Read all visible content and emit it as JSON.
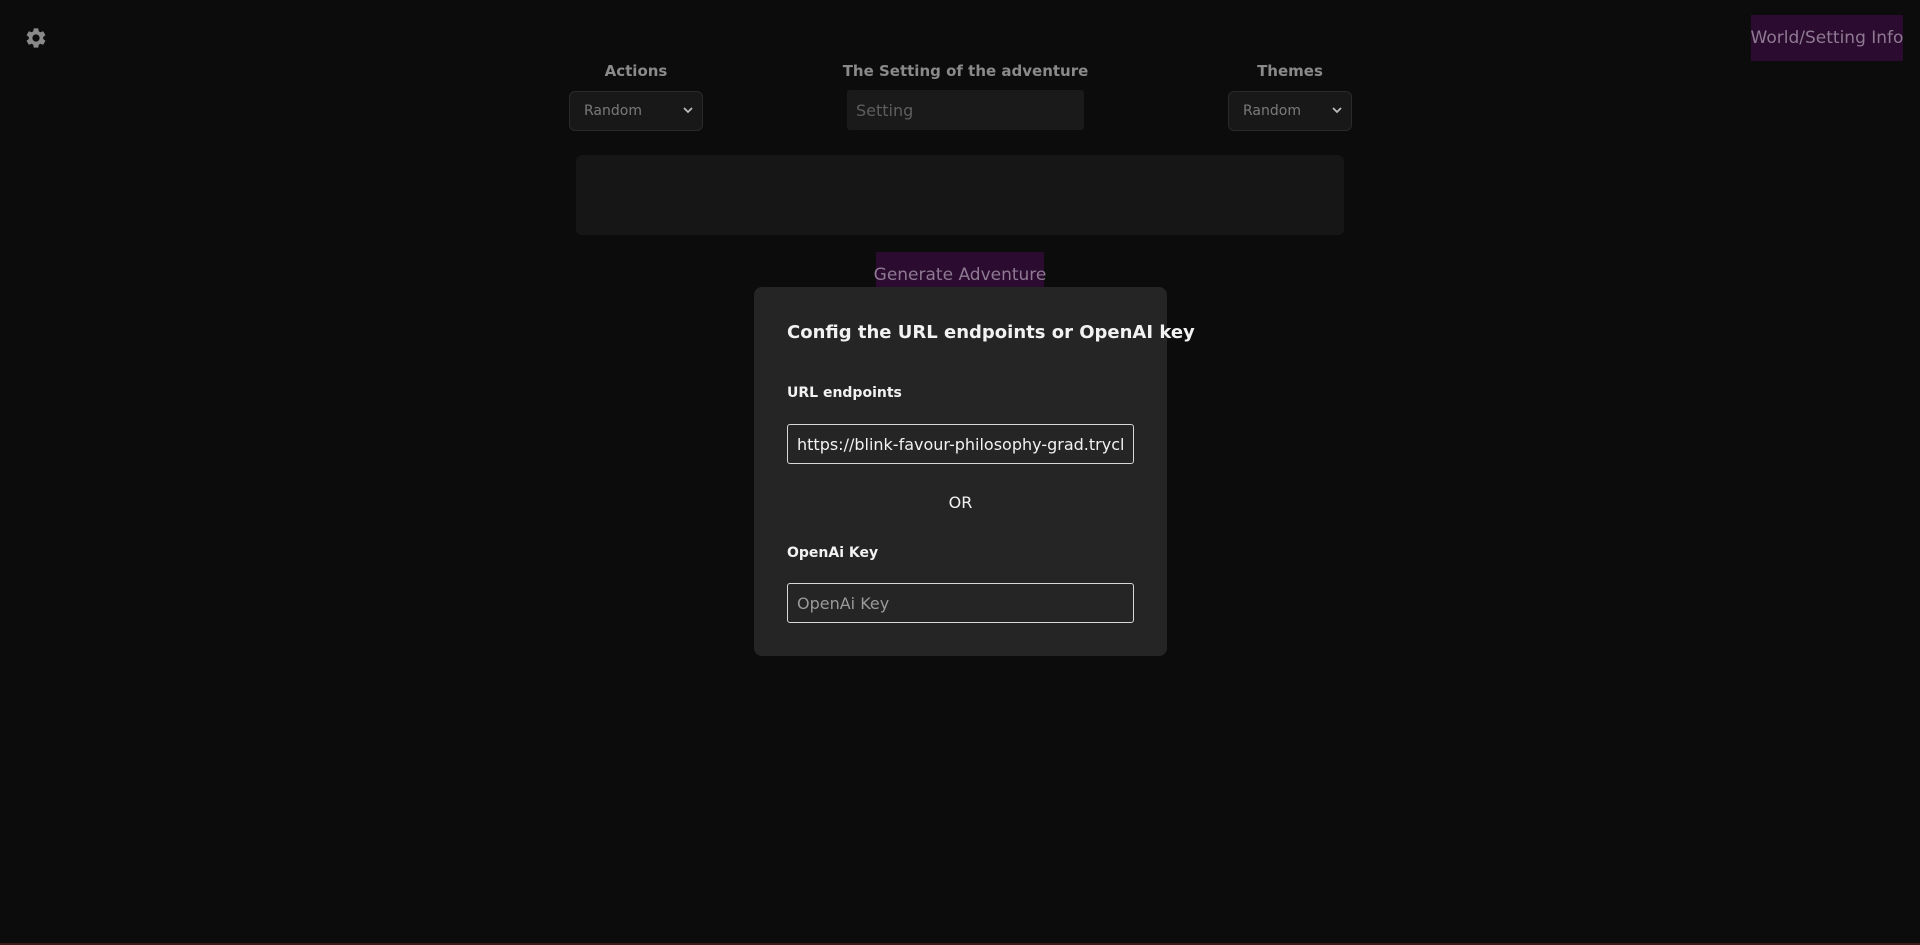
{
  "header": {
    "settings_icon": "gear-icon",
    "world_button_label": "World/Setting Info"
  },
  "controls": {
    "actions_label": "Actions",
    "actions_selected": "Random",
    "setting_label": "The Setting of the adventure",
    "setting_placeholder": "Setting",
    "themes_label": "Themes",
    "themes_selected": "Random"
  },
  "main": {
    "generate_label": "Generate Adventure"
  },
  "modal": {
    "title": "Config the URL endpoints or OpenAI key",
    "url_label": "URL endpoints",
    "url_value": "https://blink-favour-philosophy-grad.tryclou",
    "or_text": "OR",
    "key_label": "OpenAi Key",
    "key_placeholder": "OpenAi Key"
  },
  "colors": {
    "background": "#0c0c0c",
    "accent": "#2b0b30",
    "modal_bg": "#252525"
  }
}
